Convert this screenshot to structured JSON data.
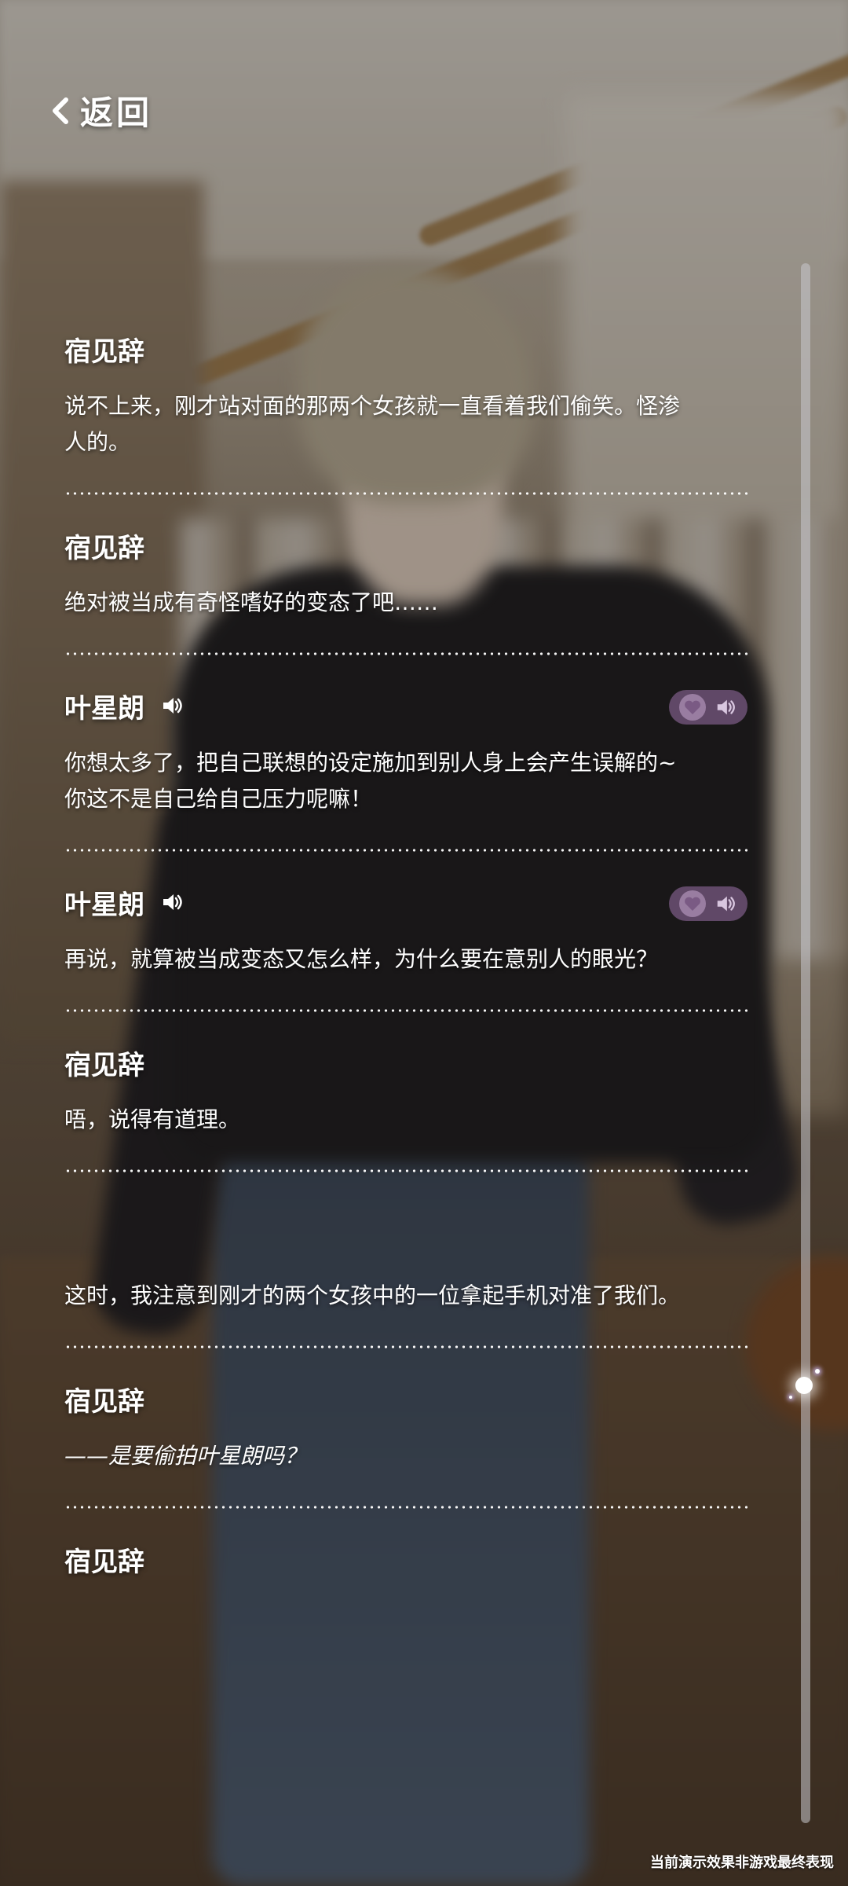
{
  "header": {
    "back_label": "返回"
  },
  "dialogue": [
    {
      "speaker": "宿见辞",
      "voice": false,
      "text": "说不上来，刚才站对面的那两个女孩就一直看着我们偷笑。怪渗人的。"
    },
    {
      "speaker": "宿见辞",
      "voice": false,
      "text": "绝对被当成有奇怪嗜好的变态了吧……"
    },
    {
      "speaker": "叶星朗",
      "voice": true,
      "text": "你想太多了，把自己联想的设定施加到别人身上会产生误解的~你这不是自己给自己压力呢嘛！"
    },
    {
      "speaker": "叶星朗",
      "voice": true,
      "text": "再说，就算被当成变态又怎么样，为什么要在意别人的眼光？"
    },
    {
      "speaker": "宿见辞",
      "voice": false,
      "text": "唔，说得有道理。"
    },
    {
      "speaker": "",
      "voice": false,
      "text": "这时，我注意到刚才的两个女孩中的一位拿起手机对准了我们。"
    },
    {
      "speaker": "宿见辞",
      "voice": false,
      "text": "——是要偷拍叶星朗吗？"
    },
    {
      "speaker": "宿见辞",
      "voice": false,
      "text": ""
    }
  ],
  "footer_note": "当前演示效果非游戏最终表现",
  "colors": {
    "pill_bg": "#7a5a84",
    "text": "#ffffff"
  },
  "icons": {
    "back": "chevron-left-icon",
    "voice": "speaker-icon",
    "favorite": "heart-icon",
    "replay": "speaker-icon"
  }
}
